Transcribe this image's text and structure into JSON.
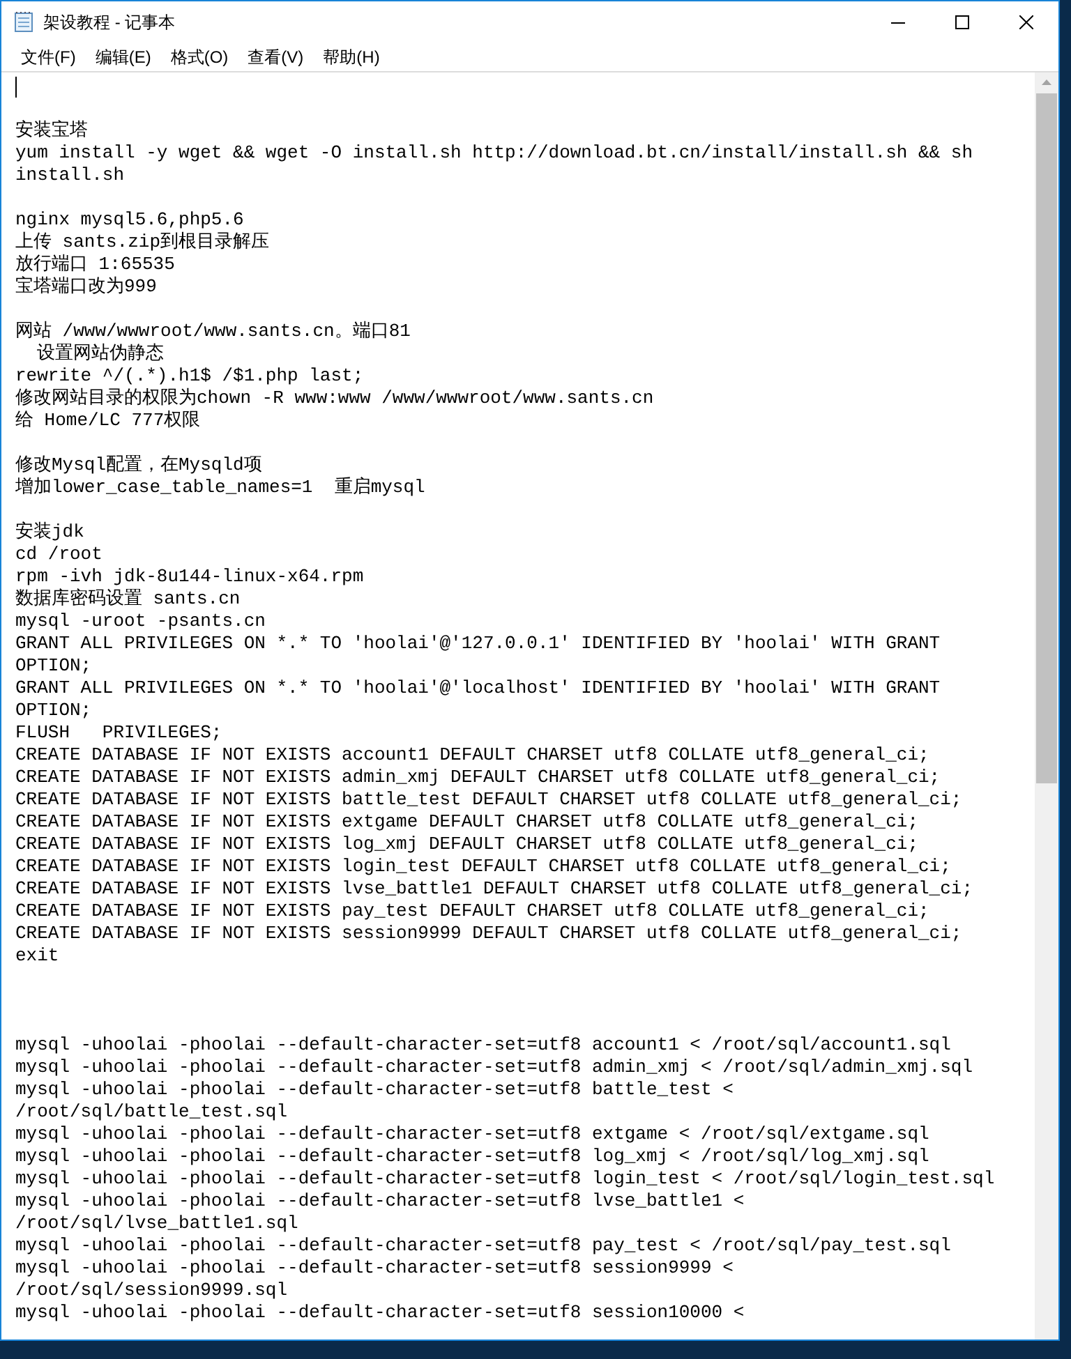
{
  "window": {
    "title": "架设教程 - 记事本"
  },
  "menu": [
    "文件(F)",
    "编辑(E)",
    "格式(O)",
    "查看(V)",
    "帮助(H)"
  ],
  "lines": [
    {
      "kind": "cursor"
    },
    {
      "kind": "blank"
    },
    {
      "kind": "text",
      "text": "安装宝塔"
    },
    {
      "kind": "text",
      "text": "yum install -y wget && wget -O install.sh http://download.bt.cn/install/install.sh && sh"
    },
    {
      "kind": "text",
      "text": "install.sh"
    },
    {
      "kind": "blank"
    },
    {
      "kind": "text",
      "text": "nginx mysql5.6,php5.6"
    },
    {
      "kind": "text",
      "text": "上传 sants.zip到根目录解压"
    },
    {
      "kind": "text",
      "text": "放行端口 1:65535"
    },
    {
      "kind": "text",
      "text": "宝塔端口改为999"
    },
    {
      "kind": "blank"
    },
    {
      "kind": "text",
      "text": "网站 /www/wwwroot/www.sants.cn。端口81"
    },
    {
      "kind": "text",
      "text": "  设置网站伪静态"
    },
    {
      "kind": "text",
      "text": "rewrite ^/(.*).h1$ /$1.php last;"
    },
    {
      "kind": "text",
      "text": "修改网站目录的权限为chown -R www:www /www/wwwroot/www.sants.cn"
    },
    {
      "kind": "text",
      "text": "给 Home/LC 777权限"
    },
    {
      "kind": "blank"
    },
    {
      "kind": "text",
      "text": "修改Mysql配置，在Mysqld项"
    },
    {
      "kind": "text",
      "text": "增加lower_case_table_names=1  重启mysql"
    },
    {
      "kind": "blank"
    },
    {
      "kind": "text",
      "text": "安装jdk"
    },
    {
      "kind": "text",
      "text": "cd /root"
    },
    {
      "kind": "text",
      "text": "rpm -ivh jdk-8u144-linux-x64.rpm"
    },
    {
      "kind": "text",
      "text": "数据库密码设置 sants.cn"
    },
    {
      "kind": "text",
      "text": "mysql -uroot -psants.cn"
    },
    {
      "kind": "text",
      "text": "GRANT ALL PRIVILEGES ON *.* TO 'hoolai'@'127.0.0.1' IDENTIFIED BY 'hoolai' WITH GRANT"
    },
    {
      "kind": "text",
      "text": "OPTION;"
    },
    {
      "kind": "text",
      "text": "GRANT ALL PRIVILEGES ON *.* TO 'hoolai'@'localhost' IDENTIFIED BY 'hoolai' WITH GRANT"
    },
    {
      "kind": "text",
      "text": "OPTION;"
    },
    {
      "kind": "text",
      "text": "FLUSH   PRIVILEGES;"
    },
    {
      "kind": "text",
      "text": "CREATE DATABASE IF NOT EXISTS account1 DEFAULT CHARSET utf8 COLLATE utf8_general_ci;"
    },
    {
      "kind": "text",
      "text": "CREATE DATABASE IF NOT EXISTS admin_xmj DEFAULT CHARSET utf8 COLLATE utf8_general_ci;"
    },
    {
      "kind": "text",
      "text": "CREATE DATABASE IF NOT EXISTS battle_test DEFAULT CHARSET utf8 COLLATE utf8_general_ci;"
    },
    {
      "kind": "text",
      "text": "CREATE DATABASE IF NOT EXISTS extgame DEFAULT CHARSET utf8 COLLATE utf8_general_ci;"
    },
    {
      "kind": "text",
      "text": "CREATE DATABASE IF NOT EXISTS log_xmj DEFAULT CHARSET utf8 COLLATE utf8_general_ci;"
    },
    {
      "kind": "text",
      "text": "CREATE DATABASE IF NOT EXISTS login_test DEFAULT CHARSET utf8 COLLATE utf8_general_ci;"
    },
    {
      "kind": "text",
      "text": "CREATE DATABASE IF NOT EXISTS lvse_battle1 DEFAULT CHARSET utf8 COLLATE utf8_general_ci;"
    },
    {
      "kind": "text",
      "text": "CREATE DATABASE IF NOT EXISTS pay_test DEFAULT CHARSET utf8 COLLATE utf8_general_ci;"
    },
    {
      "kind": "text",
      "text": "CREATE DATABASE IF NOT EXISTS session9999 DEFAULT CHARSET utf8 COLLATE utf8_general_ci;"
    },
    {
      "kind": "text",
      "text": "exit"
    },
    {
      "kind": "blank"
    },
    {
      "kind": "blank"
    },
    {
      "kind": "blank"
    },
    {
      "kind": "text",
      "text": "mysql -uhoolai -phoolai --default-character-set=utf8 account1 < /root/sql/account1.sql"
    },
    {
      "kind": "text",
      "text": "mysql -uhoolai -phoolai --default-character-set=utf8 admin_xmj < /root/sql/admin_xmj.sql"
    },
    {
      "kind": "text",
      "text": "mysql -uhoolai -phoolai --default-character-set=utf8 battle_test <"
    },
    {
      "kind": "text",
      "text": "/root/sql/battle_test.sql"
    },
    {
      "kind": "text",
      "text": "mysql -uhoolai -phoolai --default-character-set=utf8 extgame < /root/sql/extgame.sql"
    },
    {
      "kind": "text",
      "text": "mysql -uhoolai -phoolai --default-character-set=utf8 log_xmj < /root/sql/log_xmj.sql"
    },
    {
      "kind": "text",
      "text": "mysql -uhoolai -phoolai --default-character-set=utf8 login_test < /root/sql/login_test.sql"
    },
    {
      "kind": "text",
      "text": "mysql -uhoolai -phoolai --default-character-set=utf8 lvse_battle1 <"
    },
    {
      "kind": "text",
      "text": "/root/sql/lvse_battle1.sql"
    },
    {
      "kind": "text",
      "text": "mysql -uhoolai -phoolai --default-character-set=utf8 pay_test < /root/sql/pay_test.sql"
    },
    {
      "kind": "text",
      "text": "mysql -uhoolai -phoolai --default-character-set=utf8 session9999 <"
    },
    {
      "kind": "text",
      "text": "/root/sql/session9999.sql"
    },
    {
      "kind": "text",
      "text": "mysql -uhoolai -phoolai --default-character-set=utf8 session10000 <"
    }
  ]
}
